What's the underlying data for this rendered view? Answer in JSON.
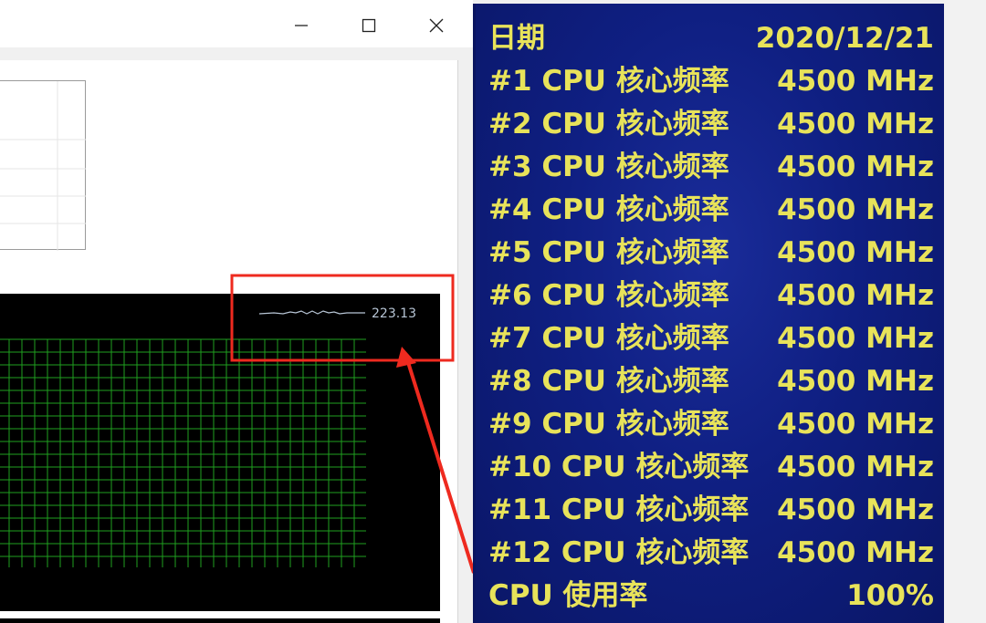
{
  "window": {
    "controls": {
      "minimize": "minimize",
      "maximize": "maximize",
      "close": "close"
    }
  },
  "graph": {
    "value": "223.13",
    "line_color": "#1fa01f",
    "trace_color": "#b8c6d6"
  },
  "osd": {
    "text_color": "#e8e35a",
    "background": "#12218a",
    "rows": [
      {
        "label": "日期",
        "value": "2020/12/21"
      },
      {
        "label": "#1 CPU 核心频率",
        "value": "4500 MHz"
      },
      {
        "label": "#2 CPU 核心频率",
        "value": "4500 MHz"
      },
      {
        "label": "#3 CPU 核心频率",
        "value": "4500 MHz"
      },
      {
        "label": "#4 CPU 核心频率",
        "value": "4500 MHz"
      },
      {
        "label": "#5 CPU 核心频率",
        "value": "4500 MHz"
      },
      {
        "label": "#6 CPU 核心频率",
        "value": "4500 MHz"
      },
      {
        "label": "#7 CPU 核心频率",
        "value": "4500 MHz"
      },
      {
        "label": "#8 CPU 核心频率",
        "value": "4500 MHz"
      },
      {
        "label": "#9 CPU 核心频率",
        "value": "4500 MHz"
      },
      {
        "label": "#10 CPU 核心频率",
        "value": "4500 MHz"
      },
      {
        "label": "#11 CPU 核心频率",
        "value": "4500 MHz"
      },
      {
        "label": "#12 CPU 核心频率",
        "value": "4500 MHz"
      },
      {
        "label": "CPU 使用率",
        "value": "100%"
      }
    ]
  },
  "annotation": {
    "color": "#ee2a1f"
  }
}
